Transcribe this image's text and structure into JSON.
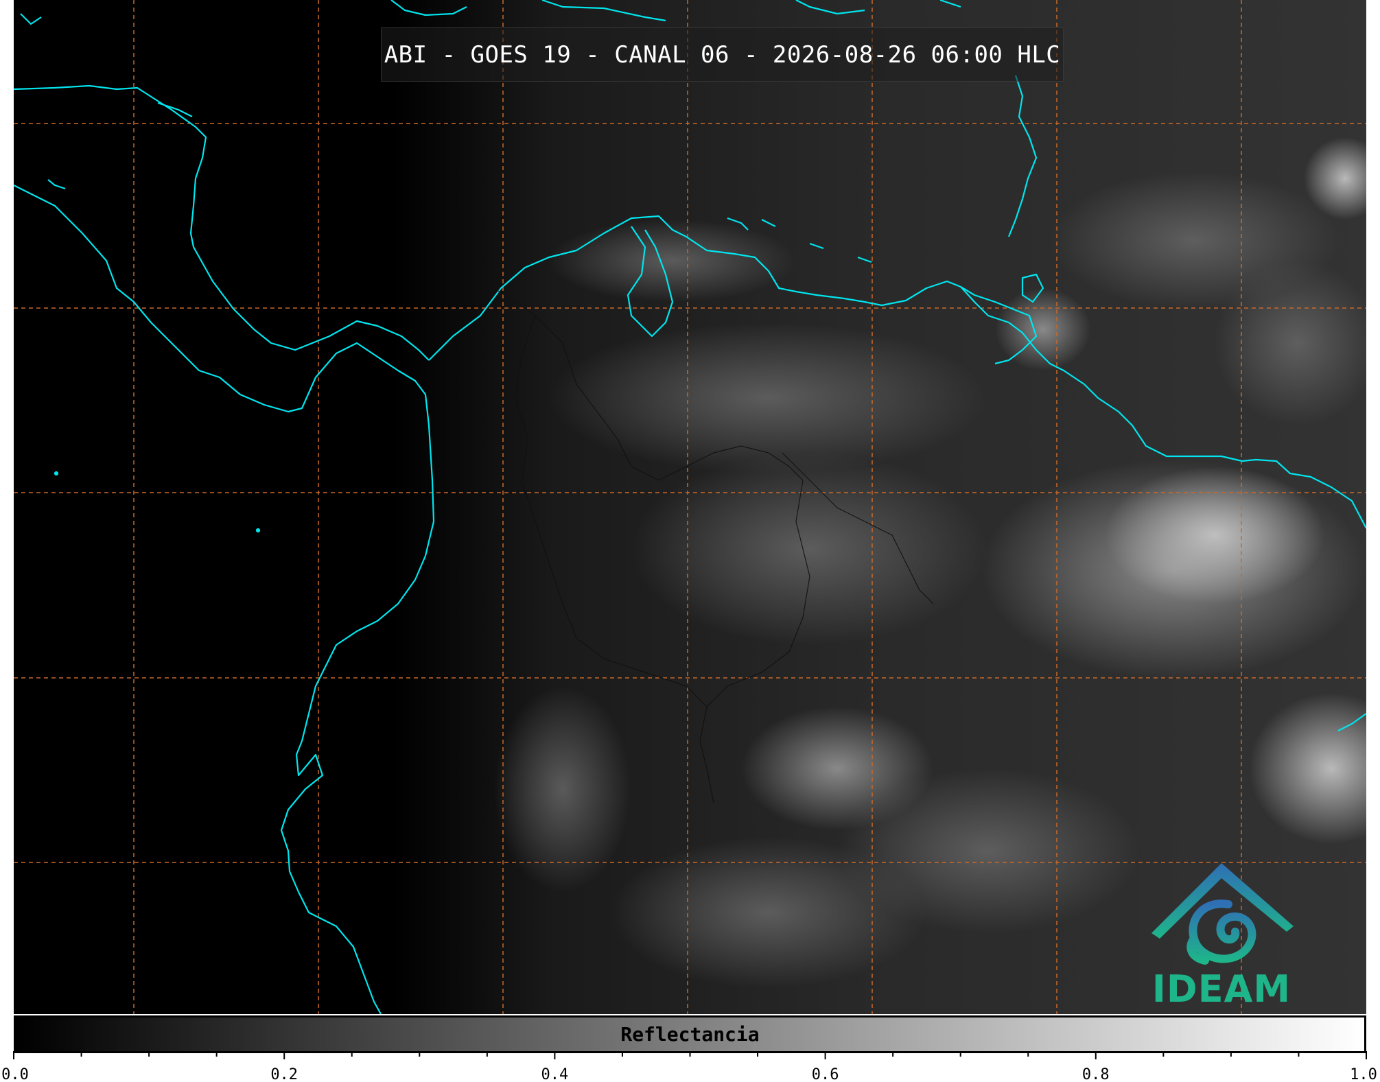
{
  "title": "ABI - GOES 19 - CANAL 06 - 2026-08-26 06:00 HLC",
  "colorbar": {
    "label": "Reflectancia",
    "range": [
      0.0,
      1.0
    ],
    "tick_labels": [
      "0.0",
      "0.2",
      "0.4",
      "0.6",
      "0.8",
      "1.0"
    ],
    "gradient_start": "#000000",
    "gradient_end": "#ffffff"
  },
  "logo": {
    "text": "IDEAM",
    "color_top": "#2f6fb5",
    "color_bottom": "#1fb58a"
  },
  "colors": {
    "coastline": "#00e5ee",
    "gridline": "#c8692a",
    "borders": "#111111",
    "background": "#000000"
  }
}
